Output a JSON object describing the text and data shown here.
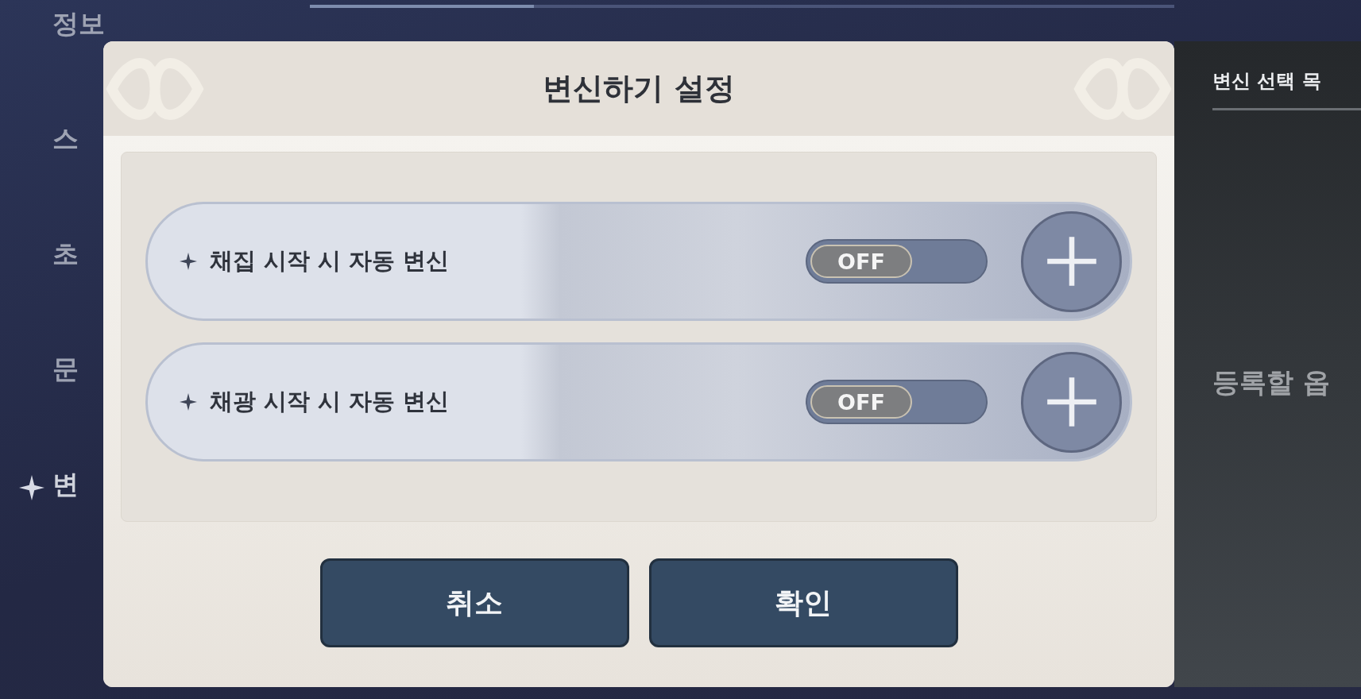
{
  "sidebar": {
    "items": [
      {
        "label": "정보",
        "selected": false
      },
      {
        "label": "스",
        "selected": false
      },
      {
        "label": "초",
        "selected": false
      },
      {
        "label": "문",
        "selected": false
      },
      {
        "label": "변",
        "selected": true
      }
    ]
  },
  "top_slider": {
    "level": 0.25
  },
  "right_panel": {
    "title": "변신 선택 목",
    "empty_text": "등록할 옵"
  },
  "dialog": {
    "title": "변신하기 설정",
    "options": [
      {
        "label": "채집 시작 시 자동 변신",
        "on": false,
        "toggle_label": "OFF"
      },
      {
        "label": "채광 시작 시 자동 변신",
        "on": false,
        "toggle_label": "OFF"
      }
    ],
    "buttons": [
      {
        "label": "취소"
      },
      {
        "label": "확인"
      }
    ]
  }
}
